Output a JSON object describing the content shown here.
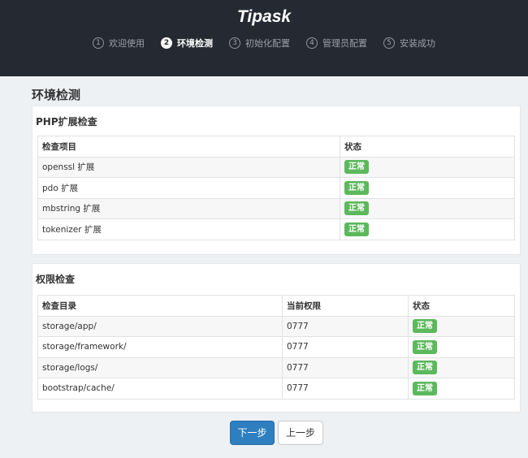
{
  "brand": "Tipask",
  "steps": [
    {
      "num": "1",
      "label": "欢迎使用"
    },
    {
      "num": "2",
      "label": "环境检测"
    },
    {
      "num": "3",
      "label": "初始化配置"
    },
    {
      "num": "4",
      "label": "管理员配置"
    },
    {
      "num": "5",
      "label": "安装成功"
    }
  ],
  "page_title": "环境检测",
  "php_panel": {
    "title": "PHP扩展检查",
    "headers": [
      "检查项目",
      "状态"
    ],
    "rows": [
      {
        "item": "openssl 扩展",
        "status": "正常"
      },
      {
        "item": "pdo 扩展",
        "status": "正常"
      },
      {
        "item": "mbstring 扩展",
        "status": "正常"
      },
      {
        "item": "tokenizer 扩展",
        "status": "正常"
      }
    ]
  },
  "perm_panel": {
    "title": "权限检查",
    "headers": [
      "检查目录",
      "当前权限",
      "状态"
    ],
    "rows": [
      {
        "dir": "storage/app/",
        "perm": "0777",
        "status": "正常"
      },
      {
        "dir": "storage/framework/",
        "perm": "0777",
        "status": "正常"
      },
      {
        "dir": "storage/logs/",
        "perm": "0777",
        "status": "正常"
      },
      {
        "dir": "bootstrap/cache/",
        "perm": "0777",
        "status": "正常"
      }
    ]
  },
  "buttons": {
    "next": "下一步",
    "prev": "上一步"
  },
  "colors": {
    "header_bg": "#252a32",
    "success": "#5cb85c",
    "primary": "#2e7fc0"
  }
}
